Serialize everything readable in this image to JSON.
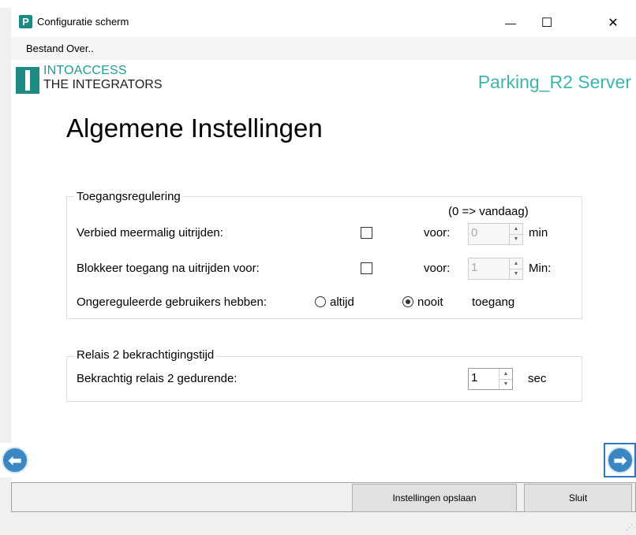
{
  "window": {
    "app_icon_letter": "P",
    "title": "Configuratie scherm",
    "minimize_glyph": "—",
    "maximize_glyph": "☐",
    "close_glyph": "✕"
  },
  "menu": {
    "items": [
      "Bestand",
      "Over.."
    ]
  },
  "brand": {
    "line1": "INTOACCESS",
    "line2": "THE INTEGRATORS",
    "server_name": "Parking_R2 Server"
  },
  "page": {
    "heading": "Algemene Instellingen"
  },
  "toegang": {
    "group_title": "Toegangsregulering",
    "hint": "(0 => vandaag)",
    "rows": [
      {
        "label": "Verbied meermalig uitrijden:",
        "voor": "voor:",
        "value": "0",
        "unit": "min"
      },
      {
        "label": "Blokkeer toegang na uitrijden voor:",
        "voor": "voor:",
        "value": "1",
        "unit": "Min:"
      }
    ],
    "onger_label": "Ongereguleerde gebruikers hebben:",
    "option_altijd": "altijd",
    "option_nooit": "nooit",
    "suffix": "toegang"
  },
  "relais": {
    "group_title": "Relais 2 bekrachtigingstijd",
    "label": "Bekrachtig relais 2 gedurende:",
    "value": "1",
    "unit": "sec"
  },
  "buttons": {
    "save": "Instellingen opslaan",
    "close": "Sluit"
  },
  "colors": {
    "brand_teal": "#1e8a84",
    "server_text": "#3fb4ad",
    "nav_blue": "#3a87c4",
    "focus_blue": "#2f75c9"
  }
}
